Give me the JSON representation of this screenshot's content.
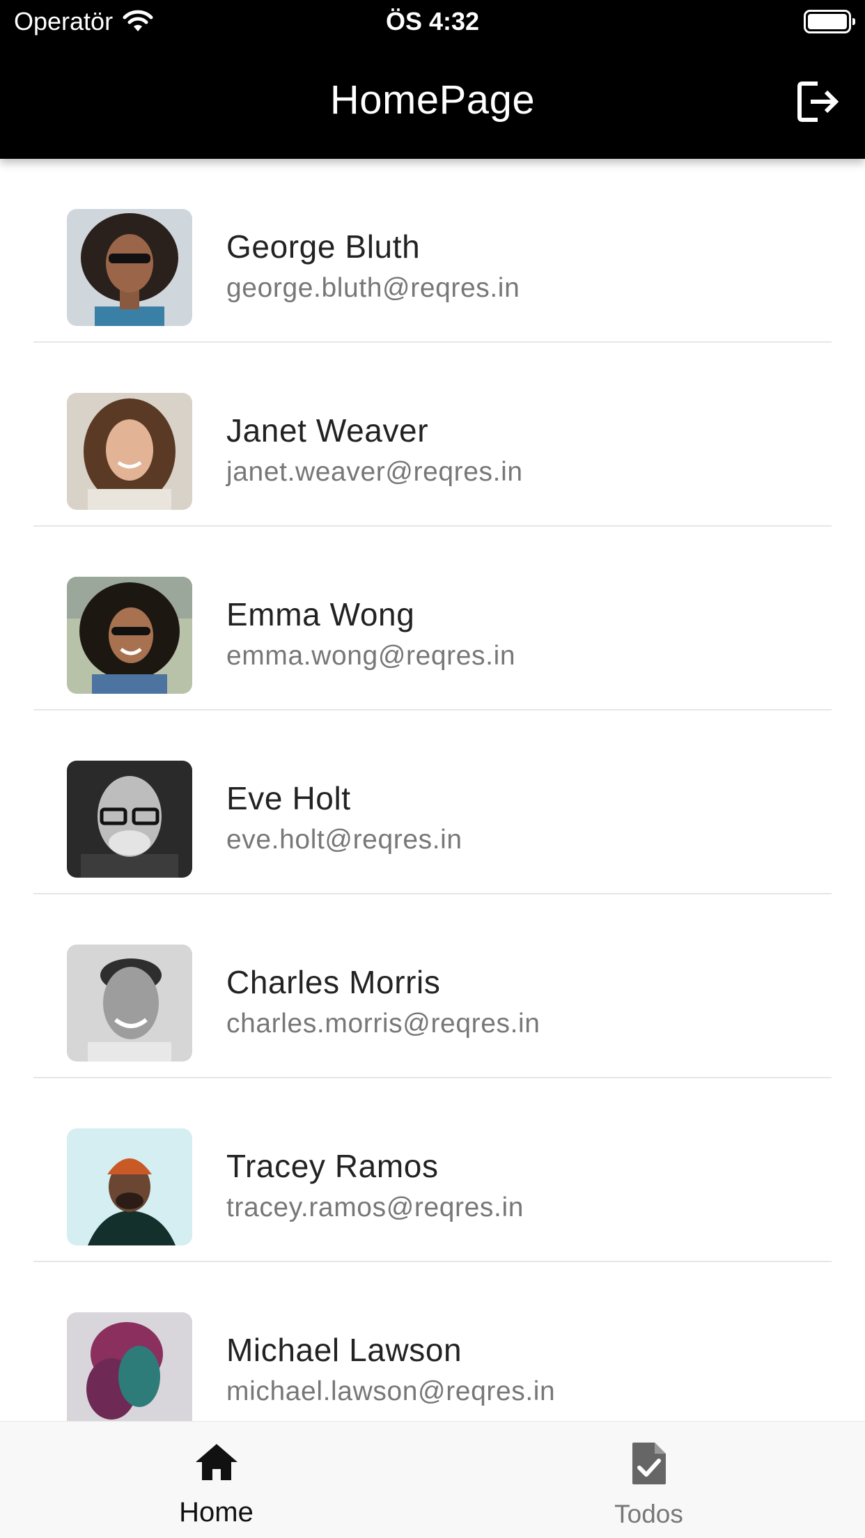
{
  "status_bar": {
    "carrier": "Operatör",
    "time": "ÖS 4:32"
  },
  "app_bar": {
    "title": "HomePage",
    "action_icon": "logout-icon"
  },
  "users": [
    {
      "name": "George Bluth",
      "email": "george.bluth@reqres.in"
    },
    {
      "name": "Janet Weaver",
      "email": "janet.weaver@reqres.in"
    },
    {
      "name": "Emma Wong",
      "email": "emma.wong@reqres.in"
    },
    {
      "name": "Eve Holt",
      "email": "eve.holt@reqres.in"
    },
    {
      "name": "Charles Morris",
      "email": "charles.morris@reqres.in"
    },
    {
      "name": "Tracey Ramos",
      "email": "tracey.ramos@reqres.in"
    },
    {
      "name": "Michael Lawson",
      "email": "michael.lawson@reqres.in"
    }
  ],
  "bottom_nav": {
    "items": [
      {
        "label": "Home",
        "icon": "home-icon",
        "active": true
      },
      {
        "label": "Todos",
        "icon": "todo-document-icon",
        "active": false
      }
    ]
  },
  "colors": {
    "app_bar": "#000000",
    "name_text": "#222222",
    "email_text": "#777777",
    "divider": "#e6e6e6",
    "bottom_nav_bg": "#f8f8f8"
  }
}
